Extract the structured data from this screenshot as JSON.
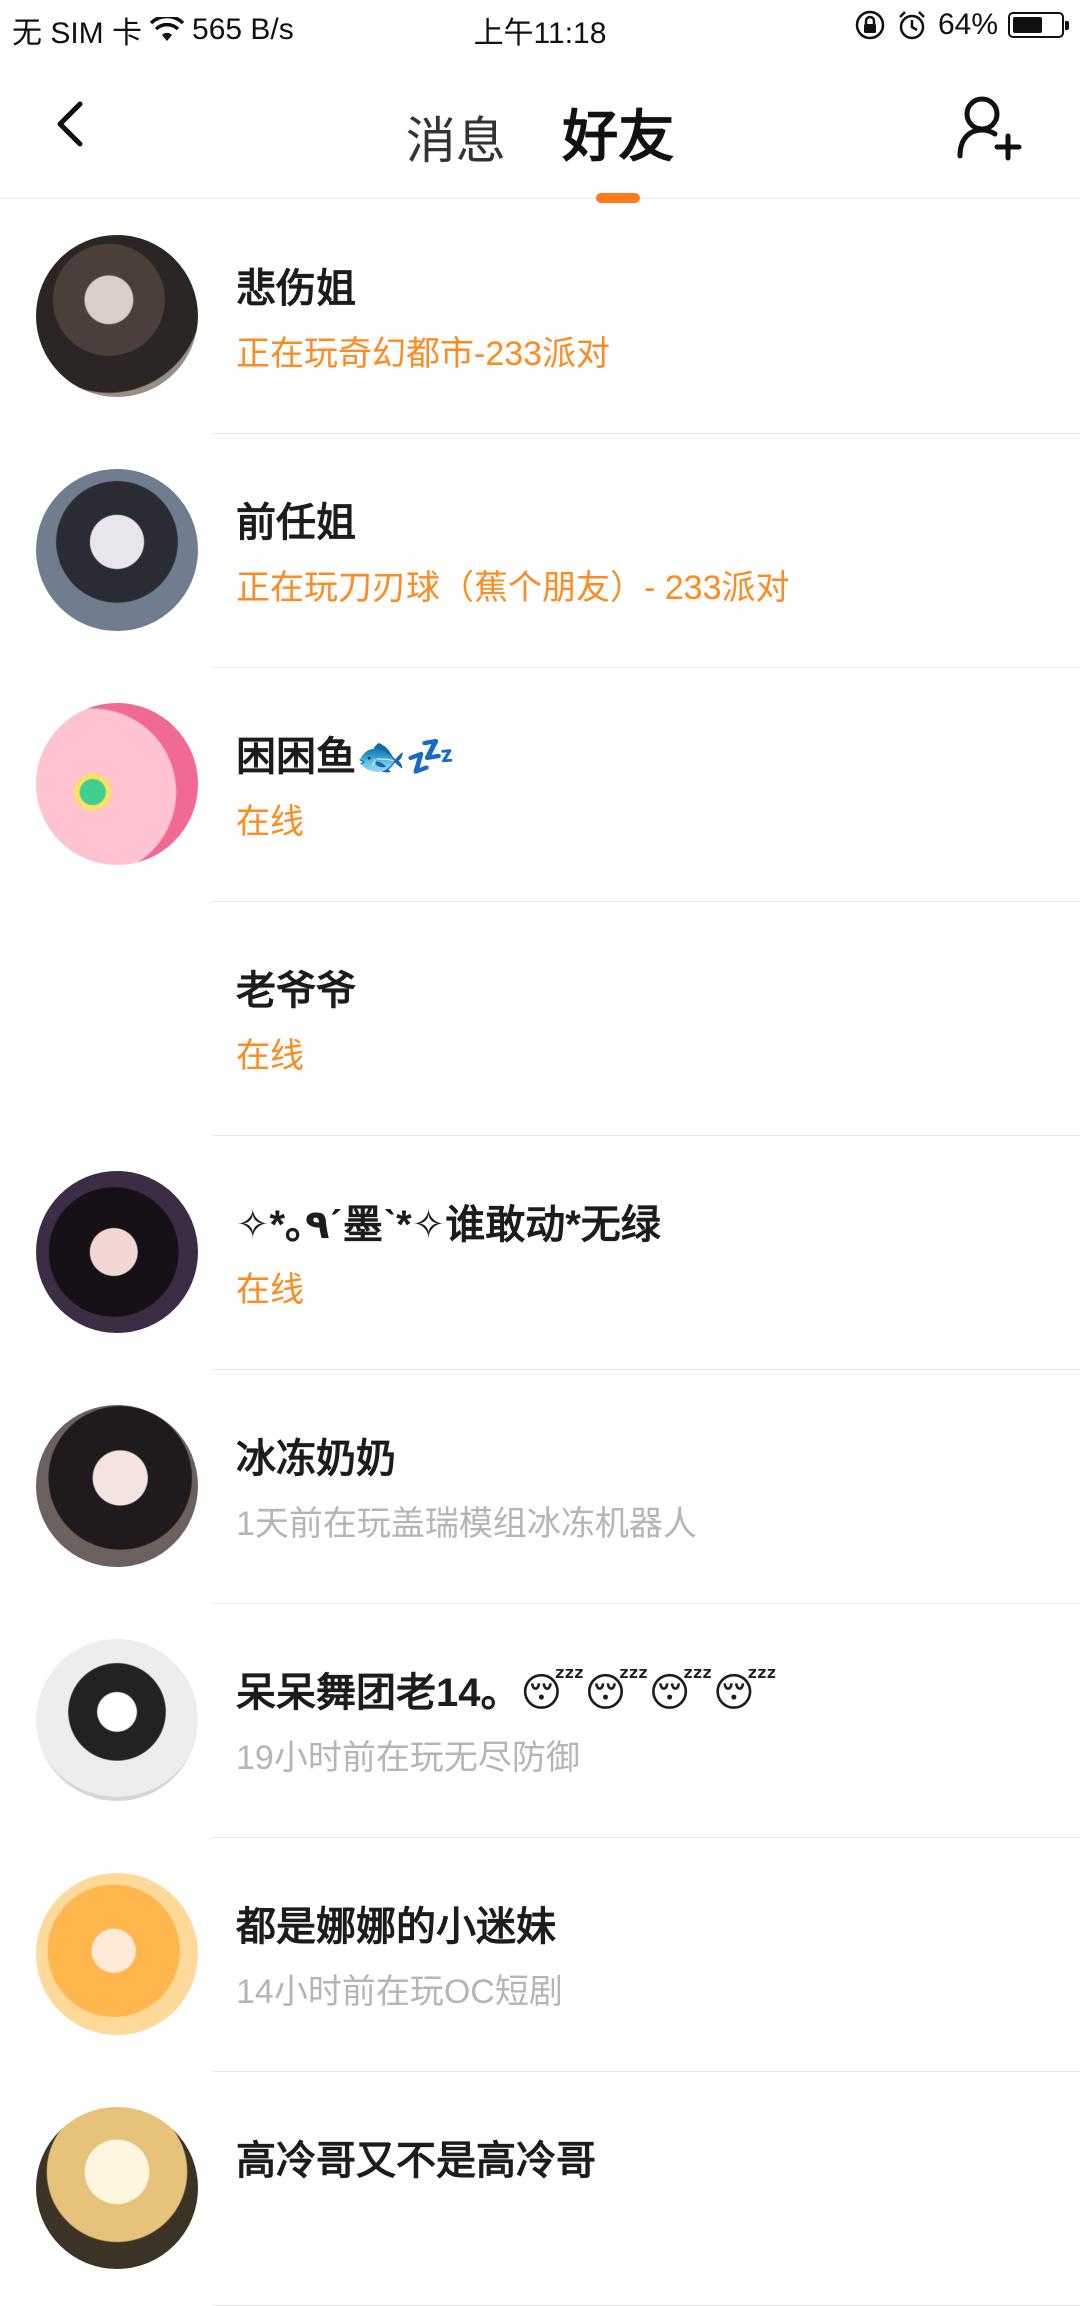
{
  "status_bar": {
    "carrier": "无 SIM 卡",
    "speed": "565 B/s",
    "time": "上午11:18",
    "battery": "64%",
    "battery_level": 0.64
  },
  "header": {
    "tab_messages": "消息",
    "tab_friends": "好友",
    "active_tab": "friends",
    "accent_color": "#ff7a1a"
  },
  "friends": [
    {
      "name": "悲伤姐",
      "status": "正在玩奇幻都市-233派对",
      "state": "online",
      "avatar": "photo"
    },
    {
      "name": "前任姐",
      "status": "正在玩刀刃球（蕉个朋友）- 233派对",
      "state": "online",
      "avatar": "photo"
    },
    {
      "name": "困困鱼🐟💤",
      "status": "在线",
      "state": "online",
      "avatar": "anime"
    },
    {
      "name": "老爷爷",
      "status": "在线",
      "state": "online",
      "avatar": "none"
    },
    {
      "name": "✧*｡٩ˊ墨ˋ*✧谁敢动*无绿",
      "status": "在线",
      "state": "online",
      "avatar": "photo"
    },
    {
      "name": "冰冻奶奶",
      "status": "1天前在玩盖瑞模组冰冻机器人",
      "state": "offline",
      "avatar": "photo"
    },
    {
      "name": "呆呆舞团老14。😴😴😴😴",
      "status": "19小时前在玩无尽防御",
      "state": "offline",
      "avatar": "anime"
    },
    {
      "name": "都是娜娜的小迷妹",
      "status": "14小时前在玩OC短剧",
      "state": "offline",
      "avatar": "anime"
    },
    {
      "name": "高冷哥又不是高冷哥",
      "status": "",
      "state": "offline",
      "avatar": "photo"
    }
  ],
  "colors": {
    "online": "#ff8a1f",
    "offline": "#b5b5b5"
  }
}
